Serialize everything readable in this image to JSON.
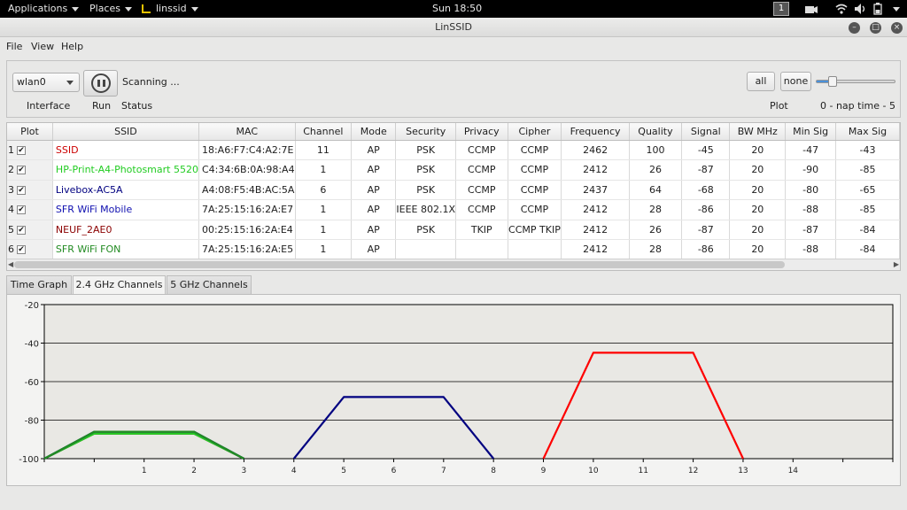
{
  "topbar": {
    "applications": "Applications",
    "places": "Places",
    "app_name": "linssid",
    "clock": "Sun 18:50",
    "workspace": "1"
  },
  "window": {
    "title": "LinSSID"
  },
  "menu": {
    "file": "File",
    "view": "View",
    "help": "Help"
  },
  "controls": {
    "interface_value": "wlan0",
    "status_text": "Scanning ...",
    "interface_label": "Interface",
    "run_label": "Run",
    "status_label": "Status",
    "all_label": "all",
    "none_label": "none",
    "plot_label": "Plot",
    "nap_label": "0 - nap time - 5",
    "nap_value": 1,
    "nap_min": 0,
    "nap_max": 5
  },
  "table": {
    "columns": [
      "Plot",
      "SSID",
      "MAC",
      "Channel",
      "Mode",
      "Security",
      "Privacy",
      "Cipher",
      "Frequency",
      "Quality",
      "Signal",
      "BW MHz",
      "Min Sig",
      "Max Sig"
    ],
    "rows": [
      {
        "num": "1",
        "ssid": "SSID",
        "color": "#cc0000",
        "mac": "18:A6:F7:C4:A2:7E",
        "channel": "11",
        "mode": "AP",
        "security": "PSK",
        "privacy": "CCMP",
        "cipher": "CCMP",
        "frequency": "2462",
        "quality": "100",
        "signal": "-45",
        "bw": "20",
        "min_sig": "-47",
        "max_sig": "-43"
      },
      {
        "num": "2",
        "ssid": "HP-Print-A4-Photosmart 5520",
        "color": "#22cc22",
        "mac": "C4:34:6B:0A:98:A4",
        "channel": "1",
        "mode": "AP",
        "security": "PSK",
        "privacy": "CCMP",
        "cipher": "CCMP",
        "frequency": "2412",
        "quality": "26",
        "signal": "-87",
        "bw": "20",
        "min_sig": "-90",
        "max_sig": "-85"
      },
      {
        "num": "3",
        "ssid": "Livebox-AC5A",
        "color": "#000080",
        "mac": "A4:08:F5:4B:AC:5A",
        "channel": "6",
        "mode": "AP",
        "security": "PSK",
        "privacy": "CCMP",
        "cipher": "CCMP",
        "frequency": "2437",
        "quality": "64",
        "signal": "-68",
        "bw": "20",
        "min_sig": "-80",
        "max_sig": "-65"
      },
      {
        "num": "4",
        "ssid": "SFR WiFi Mobile",
        "color": "#1010b0",
        "mac": "7A:25:15:16:2A:E7",
        "channel": "1",
        "mode": "AP",
        "security": "IEEE 802.1X",
        "privacy": "CCMP",
        "cipher": "CCMP",
        "frequency": "2412",
        "quality": "28",
        "signal": "-86",
        "bw": "20",
        "min_sig": "-88",
        "max_sig": "-85"
      },
      {
        "num": "5",
        "ssid": "NEUF_2AE0",
        "color": "#8b0000",
        "mac": "00:25:15:16:2A:E4",
        "channel": "1",
        "mode": "AP",
        "security": "PSK",
        "privacy": "TKIP",
        "cipher": "CCMP TKIP",
        "frequency": "2412",
        "quality": "26",
        "signal": "-87",
        "bw": "20",
        "min_sig": "-87",
        "max_sig": "-84"
      },
      {
        "num": "6",
        "ssid": "SFR WiFi FON",
        "color": "#228b22",
        "mac": "7A:25:15:16:2A:E5",
        "channel": "1",
        "mode": "AP",
        "security": "",
        "privacy": "",
        "cipher": "",
        "frequency": "2412",
        "quality": "28",
        "signal": "-86",
        "bw": "20",
        "min_sig": "-88",
        "max_sig": "-84"
      }
    ]
  },
  "tabs": [
    {
      "label": "Time Graph",
      "active": false
    },
    {
      "label": "2.4 GHz Channels",
      "active": true
    },
    {
      "label": "5 GHz Channels",
      "active": false
    }
  ],
  "chart_data": {
    "type": "line",
    "title": "",
    "xlabel": "",
    "ylabel": "",
    "xlim": [
      -1,
      16
    ],
    "ylim": [
      -100,
      -20
    ],
    "x_ticks": [
      1,
      2,
      3,
      4,
      5,
      6,
      7,
      8,
      9,
      10,
      11,
      12,
      13,
      14
    ],
    "y_ticks": [
      -20,
      -40,
      -60,
      -80,
      -100
    ],
    "grid": true,
    "series": [
      {
        "name": "SSID",
        "color": "#ff0000",
        "channel": 11,
        "signal": -45,
        "x": [
          9,
          10,
          12,
          13
        ],
        "y": [
          -100,
          -45,
          -45,
          -100
        ]
      },
      {
        "name": "Livebox-AC5A",
        "color": "#000080",
        "channel": 6,
        "signal": -68,
        "x": [
          4,
          5,
          7,
          8
        ],
        "y": [
          -100,
          -68,
          -68,
          -100
        ]
      },
      {
        "name": "NEUF_2AE0",
        "color": "#b02020",
        "channel": 1,
        "signal": -87,
        "x": [
          -1,
          0,
          2,
          3
        ],
        "y": [
          -100,
          -87,
          -87,
          -100
        ]
      },
      {
        "name": "HP-Print-A4-Photosmart 5520",
        "color": "#22cc22",
        "channel": 1,
        "signal": -87,
        "x": [
          -1,
          0,
          2,
          3
        ],
        "y": [
          -100,
          -87,
          -87,
          -100
        ]
      },
      {
        "name": "SFR WiFi Mobile",
        "color": "#1010b0",
        "channel": 1,
        "signal": -86,
        "x": [
          -1,
          0,
          2,
          3
        ],
        "y": [
          -100,
          -86,
          -86,
          -100
        ]
      },
      {
        "name": "SFR WiFi FON",
        "color": "#228b22",
        "channel": 1,
        "signal": -86,
        "x": [
          -1,
          0,
          2,
          3
        ],
        "y": [
          -100,
          -86,
          -86,
          -100
        ]
      }
    ]
  }
}
